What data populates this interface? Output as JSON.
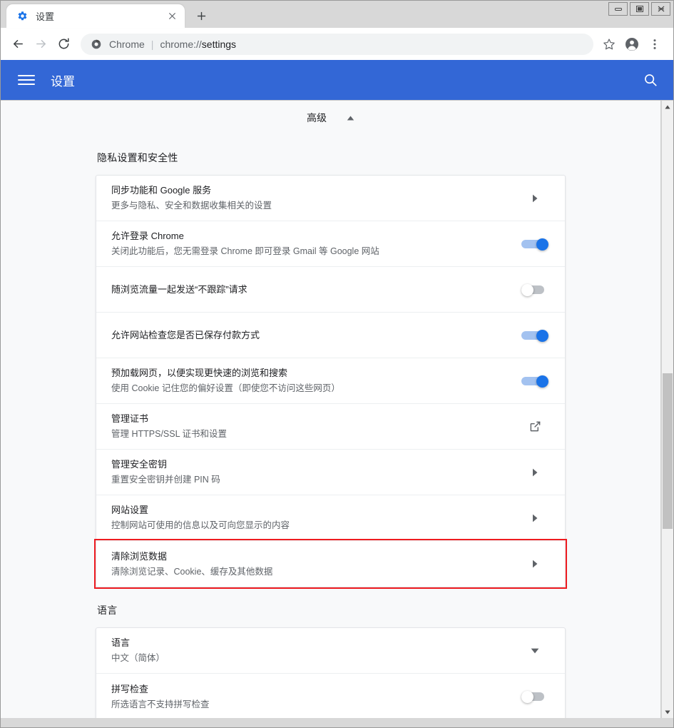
{
  "window": {
    "controls": [
      {
        "name": "minimize",
        "glyph": "—"
      },
      {
        "name": "maximize",
        "glyph": "□"
      },
      {
        "name": "close",
        "glyph": "✕"
      }
    ]
  },
  "tab": {
    "title": "设置",
    "favicon": "gear-icon",
    "close_label": "✕",
    "newtab_label": "+"
  },
  "toolbar": {
    "back": "←",
    "forward": "→",
    "reload": "⟳",
    "omnibox": {
      "icon": "chrome-logo-icon",
      "scheme_label": "Chrome",
      "separator": "|",
      "url_prefix": "chrome://",
      "url_suffix": "settings",
      "full_url": "chrome://settings"
    },
    "bookmark": "☆",
    "profile": "profile-avatar-icon",
    "menu": "⋮"
  },
  "settings_header": {
    "menu_icon": "hamburger-icon",
    "title": "设置",
    "search_icon": "search-icon"
  },
  "advanced": {
    "label": "高级",
    "chevron": "chevron-up-icon"
  },
  "sections": [
    {
      "id": "privacy",
      "title": "隐私设置和安全性",
      "rows": [
        {
          "title": "同步功能和 Google 服务",
          "sub": "更多与隐私、安全和数据收集相关的设置",
          "control": "chevron-right"
        },
        {
          "title": "允许登录 Chrome",
          "sub": "关闭此功能后，您无需登录 Chrome 即可登录 Gmail 等 Google 网站",
          "control": "toggle-on"
        },
        {
          "title": "随浏览流量一起发送“不跟踪”请求",
          "sub": "",
          "control": "toggle-off"
        },
        {
          "title": "允许网站检查您是否已保存付款方式",
          "sub": "",
          "control": "toggle-on"
        },
        {
          "title": "预加载网页，以便实现更快速的浏览和搜索",
          "sub": "使用 Cookie 记住您的偏好设置（即使您不访问这些网页）",
          "control": "toggle-on"
        },
        {
          "title": "管理证书",
          "sub": "管理 HTTPS/SSL 证书和设置",
          "control": "external-link"
        },
        {
          "title": "管理安全密钥",
          "sub": "重置安全密钥并创建 PIN 码",
          "control": "chevron-right"
        },
        {
          "title": "网站设置",
          "sub": "控制网站可使用的信息以及可向您显示的内容",
          "control": "chevron-right"
        },
        {
          "title": "清除浏览数据",
          "sub": "清除浏览记录、Cookie、缓存及其他数据",
          "control": "chevron-right",
          "highlighted": true
        }
      ]
    },
    {
      "id": "languages",
      "title": "语言",
      "rows": [
        {
          "title": "语言",
          "sub": "中文（简体）",
          "control": "chevron-down"
        },
        {
          "title": "拼写检查",
          "sub": "所选语言不支持拼写检查",
          "control": "toggle-off"
        }
      ]
    }
  ],
  "scrollbar": {
    "up_arrow": "▲",
    "down_arrow": "▼"
  },
  "colors": {
    "header_blue": "#3367d6",
    "toggle_on": "#1a73e8",
    "toggle_on_track": "#a3c2f0",
    "toggle_off": "#bdc1c6",
    "highlight_red": "#ee1c21",
    "page_bg": "#f8f9fa",
    "card_bg": "#ffffff",
    "text_primary": "#202124",
    "text_secondary": "#5f6368"
  }
}
